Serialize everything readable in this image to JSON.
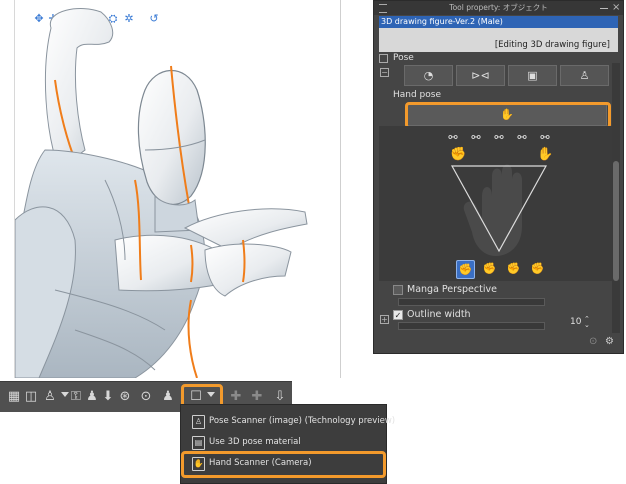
{
  "camera_icons": [
    "rotate-camera-icon",
    "pan-camera-icon",
    "move-camera-icon",
    "rotate-object-icon",
    "move-object-icon",
    "camera-view-icon",
    "settings-icon",
    "reset-icon"
  ],
  "toolbar_icons": [
    "floor-icon",
    "object-list-icon",
    "pose-figure-icon",
    "dropdown-icon",
    "unlock-icon",
    "reset-pose-icon",
    "save-pose-icon",
    "camera-reset-icon",
    "joint-icon",
    "hand-scanner-icon",
    "dropdown-icon",
    "pose-disabled-icon",
    "pose-disabled-icon",
    "fit-to-floor-icon"
  ],
  "dropdown_menu": {
    "items": [
      {
        "label": "Pose Scanner (image) (Technology preview)",
        "icon": "pose-scanner-icon"
      },
      {
        "label": "Use 3D pose material",
        "icon": "pose-material-icon"
      },
      {
        "label": "Hand Scanner (Camera)",
        "icon": "hand-scanner-icon"
      }
    ]
  },
  "tool_property": {
    "title": "Tool property: オブジェクト",
    "subtool_name": "3D drawing figure-Ver.2 (Male)",
    "editing_label": "[Editing 3D drawing figure]",
    "pose_section": "Pose",
    "hand_pose_label": "Hand pose",
    "manga_perspective_label": "Manga Perspective",
    "outline_width_label": "Outline width",
    "outline_width_value": "10"
  },
  "colors": {
    "highlight": "#f39a2c",
    "panel_bg": "#454545",
    "selection_blue": "#2e64b5",
    "toolbar_bg": "#505050"
  }
}
